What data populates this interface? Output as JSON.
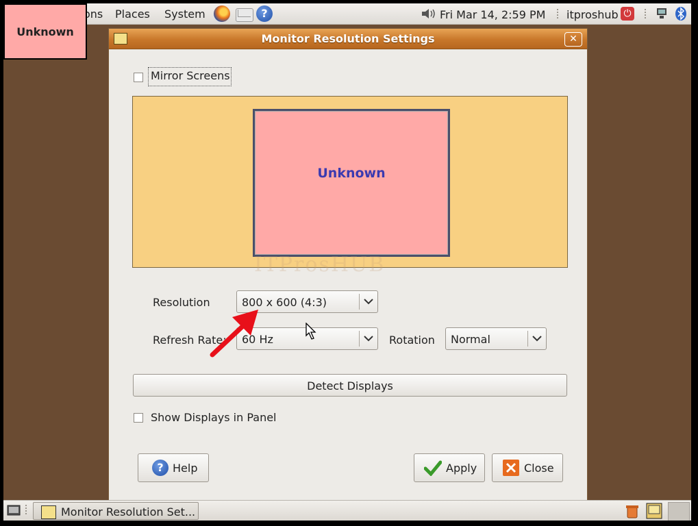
{
  "desktop": {
    "label_overlay": "Unknown"
  },
  "top_panel": {
    "menus": [
      "ons",
      "Places",
      "System"
    ],
    "clock": "Fri Mar 14,  2:59 PM",
    "user": "itproshub"
  },
  "dialog": {
    "title": "Monitor Resolution Settings",
    "mirror_label": "Mirror Screens",
    "mirror_checked": false,
    "monitor_name": "Unknown",
    "watermark": "ITProsHUB",
    "resolution_label": "Resolution",
    "resolution_value": "800 x 600 (4:3)",
    "refresh_label": "Refresh Rate:",
    "refresh_value": "60 Hz",
    "rotation_label": "Rotation",
    "rotation_value": "Normal",
    "detect_label": "Detect Displays",
    "show_panel_label": "Show Displays in Panel",
    "show_panel_checked": false,
    "help_label": "Help",
    "apply_label": "Apply",
    "close_label": "Close"
  },
  "bottom_panel": {
    "task_label": "Monitor Resolution Set..."
  },
  "colors": {
    "accent_orange": "#c8772a",
    "preview_bg": "#f8d082",
    "monitor_fill": "#ffa9a7",
    "desktop_brown": "#6a4b32",
    "annotation_red": "#e8101a"
  }
}
